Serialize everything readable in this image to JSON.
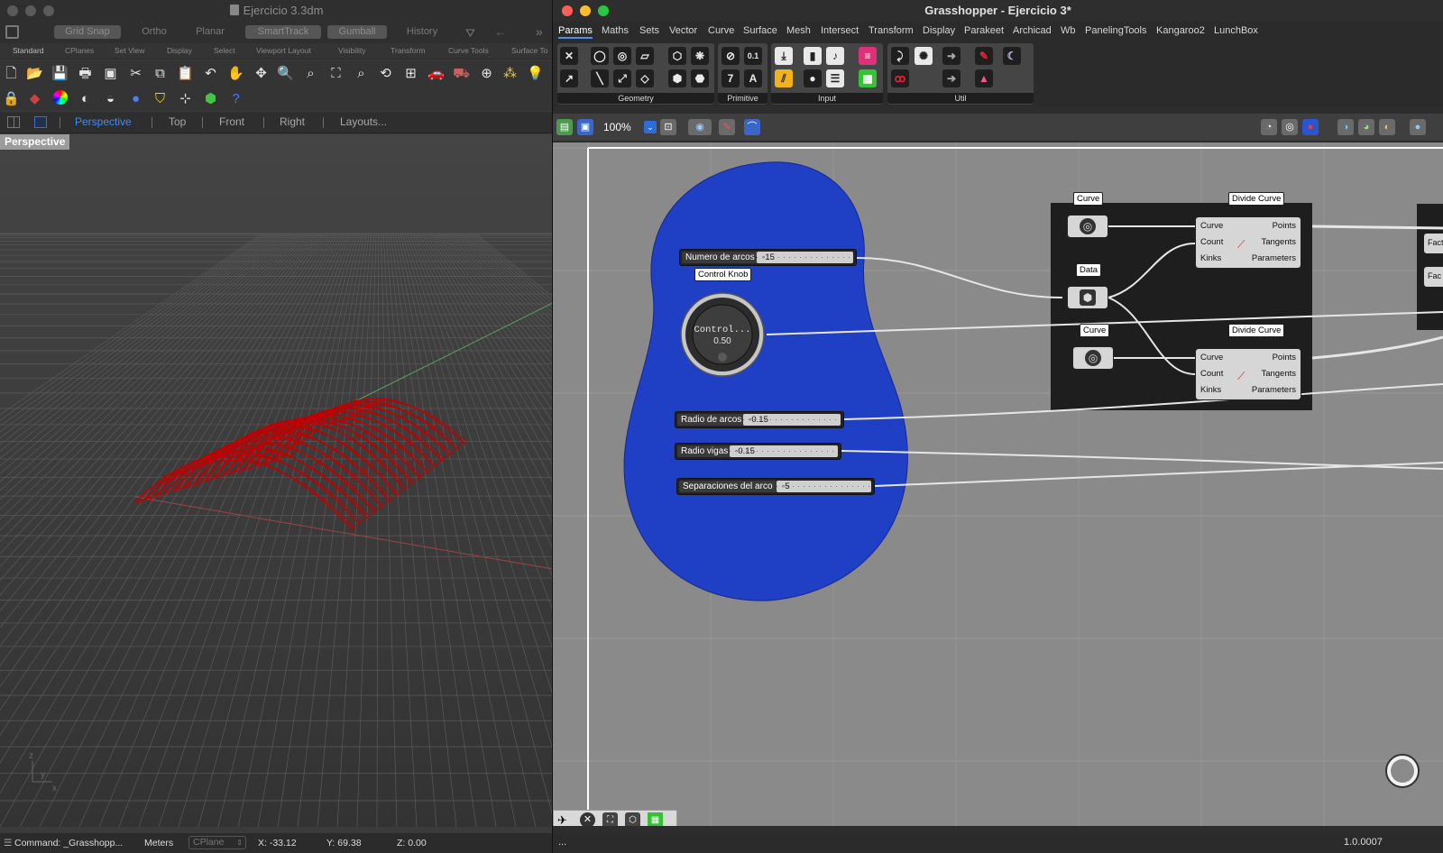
{
  "rhino": {
    "title": "Ejercicio 3.3dm",
    "modes": [
      {
        "label": "Grid Snap",
        "active": true
      },
      {
        "label": "Ortho",
        "active": false
      },
      {
        "label": "Planar",
        "active": false
      },
      {
        "label": "SmartTrack",
        "active": true
      },
      {
        "label": "Gumball",
        "active": true
      },
      {
        "label": "History",
        "active": false
      }
    ],
    "toolbar_tabs": [
      "Standard",
      "CPlanes",
      "Set View",
      "Display",
      "Select",
      "Viewport Layout",
      "Visibility",
      "Transform",
      "Curve Tools",
      "Surface To"
    ],
    "viewport_tabs": [
      "Perspective",
      "Top",
      "Front",
      "Right",
      "Layouts..."
    ],
    "viewport_label": "Perspective",
    "axis_labels": {
      "z": "z",
      "y": "y",
      "x": "x"
    },
    "status": {
      "command": "Command: _Grasshopp...",
      "units": "Meters",
      "cplane": "CPlane",
      "x": "X: -33.12",
      "y": "Y: 69.38",
      "z": "Z: 0.00"
    }
  },
  "grasshopper": {
    "title": "Grasshopper - Ejercicio 3*",
    "menu": [
      "Params",
      "Maths",
      "Sets",
      "Vector",
      "Curve",
      "Surface",
      "Mesh",
      "Intersect",
      "Transform",
      "Display",
      "Parakeet",
      "Archicad",
      "Wb",
      "PanelingTools",
      "Kangaroo2",
      "LunchBox"
    ],
    "ribbon_panels": [
      "Geometry",
      "Primitive",
      "Input",
      "Util"
    ],
    "zoom": "100%",
    "bottom_left": "...",
    "version": "1.0.0007",
    "canvas": {
      "sliders": [
        {
          "name": "Numero de arcos",
          "value": "15"
        },
        {
          "name": "Radio de arcos",
          "value": "0.15"
        },
        {
          "name": "Radio vigas",
          "value": "0.15"
        },
        {
          "name": "Separaciones del arco",
          "value": "5"
        }
      ],
      "knob": {
        "tag": "Control Knob",
        "name": "Control...",
        "value": "0.50"
      },
      "params": [
        {
          "tag": "Curve"
        },
        {
          "tag": "Data"
        },
        {
          "tag": "Curve"
        }
      ],
      "components": [
        {
          "title": "Divide Curve",
          "inputs": [
            "Curve",
            "Count",
            "Kinks"
          ],
          "outputs": [
            "Points",
            "Tangents",
            "Parameters"
          ]
        },
        {
          "title": "Divide Curve",
          "inputs": [
            "Curve",
            "Count",
            "Kinks"
          ],
          "outputs": [
            "Points",
            "Tangents",
            "Parameters"
          ]
        }
      ],
      "edge_partial": [
        "Fact",
        "Fac"
      ]
    }
  },
  "colors": {
    "group_blue": "#1f3fc4",
    "arch_red": "#c00000",
    "accent_blue": "#3f8cff"
  }
}
